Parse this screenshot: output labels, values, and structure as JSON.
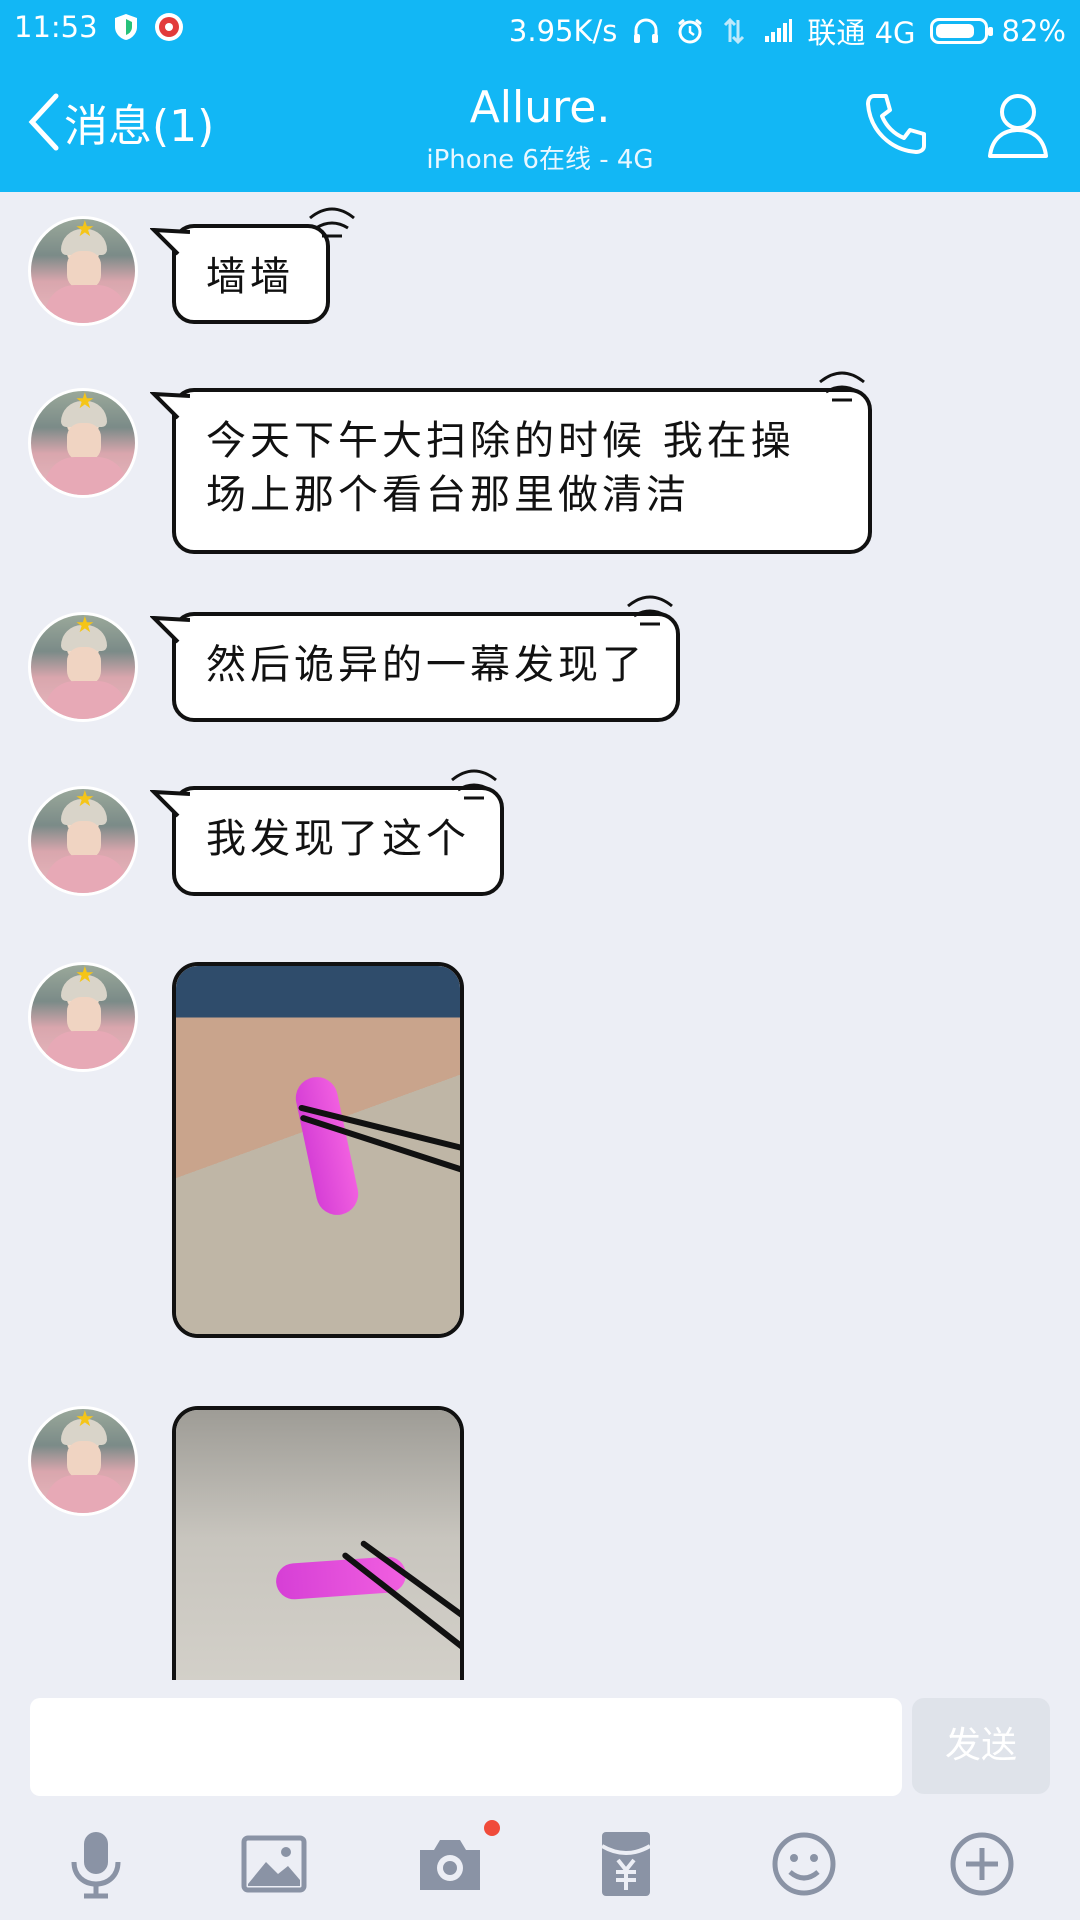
{
  "status_bar": {
    "time": "11:53",
    "speed": "3.95K/s",
    "carrier": "联通 4G",
    "battery": "82%",
    "battery_level": 0.82
  },
  "header": {
    "back_label": "消息(1)",
    "contact_name": "Allure.",
    "status_line": "iPhone 6在线 - 4G"
  },
  "messages": [
    {
      "type": "text",
      "text": "墙墙"
    },
    {
      "type": "text",
      "text": "今天下午大扫除的时候 我在操场上那个看台那里做清洁"
    },
    {
      "type": "text",
      "text": "然后诡异的一幕发现了"
    },
    {
      "type": "text",
      "text": "我发现了这个"
    },
    {
      "type": "image"
    },
    {
      "type": "image"
    }
  ],
  "composer": {
    "input_value": "",
    "send_label": "发送"
  },
  "toolbar": {
    "icons": [
      "microphone-icon",
      "image-icon",
      "camera-icon",
      "red-envelope-icon",
      "emoji-icon",
      "plus-icon"
    ]
  },
  "colors": {
    "brand_blue": "#12b7f5",
    "background": "#eceef5",
    "notification_dot": "#f04b3a"
  }
}
